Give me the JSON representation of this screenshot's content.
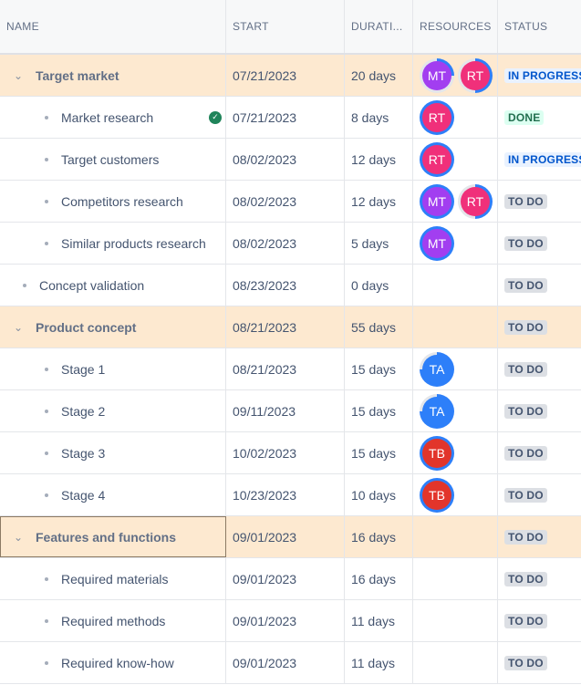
{
  "headers": [
    "NAME",
    "START",
    "DURATI...",
    "RESOURCES",
    "STATUS"
  ],
  "colors": {
    "MT": "#a23ef0",
    "RT": "#f0307a",
    "TA": "#2d7ff9",
    "TB": "#e2352b",
    "ring": "#2d7ff9"
  },
  "rows": [
    {
      "name": "Target market",
      "group": true,
      "start": "07/21/2023",
      "duration": "20 days",
      "resources": [
        {
          "initials": "MT",
          "progress": 0.25
        },
        {
          "initials": "RT",
          "progress": 0.5
        }
      ],
      "status": "IN PROGRESS",
      "kind": "prog"
    },
    {
      "name": "Market research",
      "level": 2,
      "done_icon": true,
      "start": "07/21/2023",
      "duration": "8 days",
      "resources": [
        {
          "initials": "RT",
          "progress": 1
        }
      ],
      "status": "DONE",
      "kind": "done"
    },
    {
      "name": "Target customers",
      "level": 2,
      "start": "08/02/2023",
      "duration": "12 days",
      "resources": [
        {
          "initials": "RT",
          "progress": 1
        }
      ],
      "status": "IN PROGRESS",
      "kind": "prog"
    },
    {
      "name": "Competitors research",
      "level": 2,
      "start": "08/02/2023",
      "duration": "12 days",
      "resources": [
        {
          "initials": "MT",
          "progress": 1
        },
        {
          "initials": "RT",
          "progress": 0.5
        }
      ],
      "status": "TO DO",
      "kind": "todo"
    },
    {
      "name": "Similar products research",
      "level": 2,
      "start": "08/02/2023",
      "duration": "5 days",
      "resources": [
        {
          "initials": "MT",
          "progress": 1
        }
      ],
      "status": "TO DO",
      "kind": "todo"
    },
    {
      "name": "Concept validation",
      "level": 1,
      "start": "08/23/2023",
      "duration": "0 days",
      "resources": [],
      "status": "TO DO",
      "kind": "todo"
    },
    {
      "name": "Product concept",
      "group": true,
      "start": "08/21/2023",
      "duration": "55 days",
      "resources": [],
      "status": "TO DO",
      "kind": "todo"
    },
    {
      "name": "Stage 1",
      "level": 2,
      "start": "08/21/2023",
      "duration": "15 days",
      "resources": [
        {
          "initials": "TA",
          "progress": 0.75
        }
      ],
      "status": "TO DO",
      "kind": "todo"
    },
    {
      "name": "Stage 2",
      "level": 2,
      "start": "09/11/2023",
      "duration": "15 days",
      "resources": [
        {
          "initials": "TA",
          "progress": 0.75
        }
      ],
      "status": "TO DO",
      "kind": "todo"
    },
    {
      "name": "Stage 3",
      "level": 2,
      "start": "10/02/2023",
      "duration": "15 days",
      "resources": [
        {
          "initials": "TB",
          "progress": 1
        }
      ],
      "status": "TO DO",
      "kind": "todo"
    },
    {
      "name": "Stage 4",
      "level": 2,
      "start": "10/23/2023",
      "duration": "10 days",
      "resources": [
        {
          "initials": "TB",
          "progress": 1
        }
      ],
      "status": "TO DO",
      "kind": "todo"
    },
    {
      "name": "Features and functions",
      "group": true,
      "selected": true,
      "start": "09/01/2023",
      "duration": "16 days",
      "resources": [],
      "status": "TO DO",
      "kind": "todo"
    },
    {
      "name": "Required materials",
      "level": 2,
      "start": "09/01/2023",
      "duration": "16 days",
      "resources": [],
      "status": "TO DO",
      "kind": "todo"
    },
    {
      "name": "Required methods",
      "level": 2,
      "start": "09/01/2023",
      "duration": "11 days",
      "resources": [],
      "status": "TO DO",
      "kind": "todo"
    },
    {
      "name": "Required know-how",
      "level": 2,
      "start": "09/01/2023",
      "duration": "11 days",
      "resources": [],
      "status": "TO DO",
      "kind": "todo"
    }
  ]
}
